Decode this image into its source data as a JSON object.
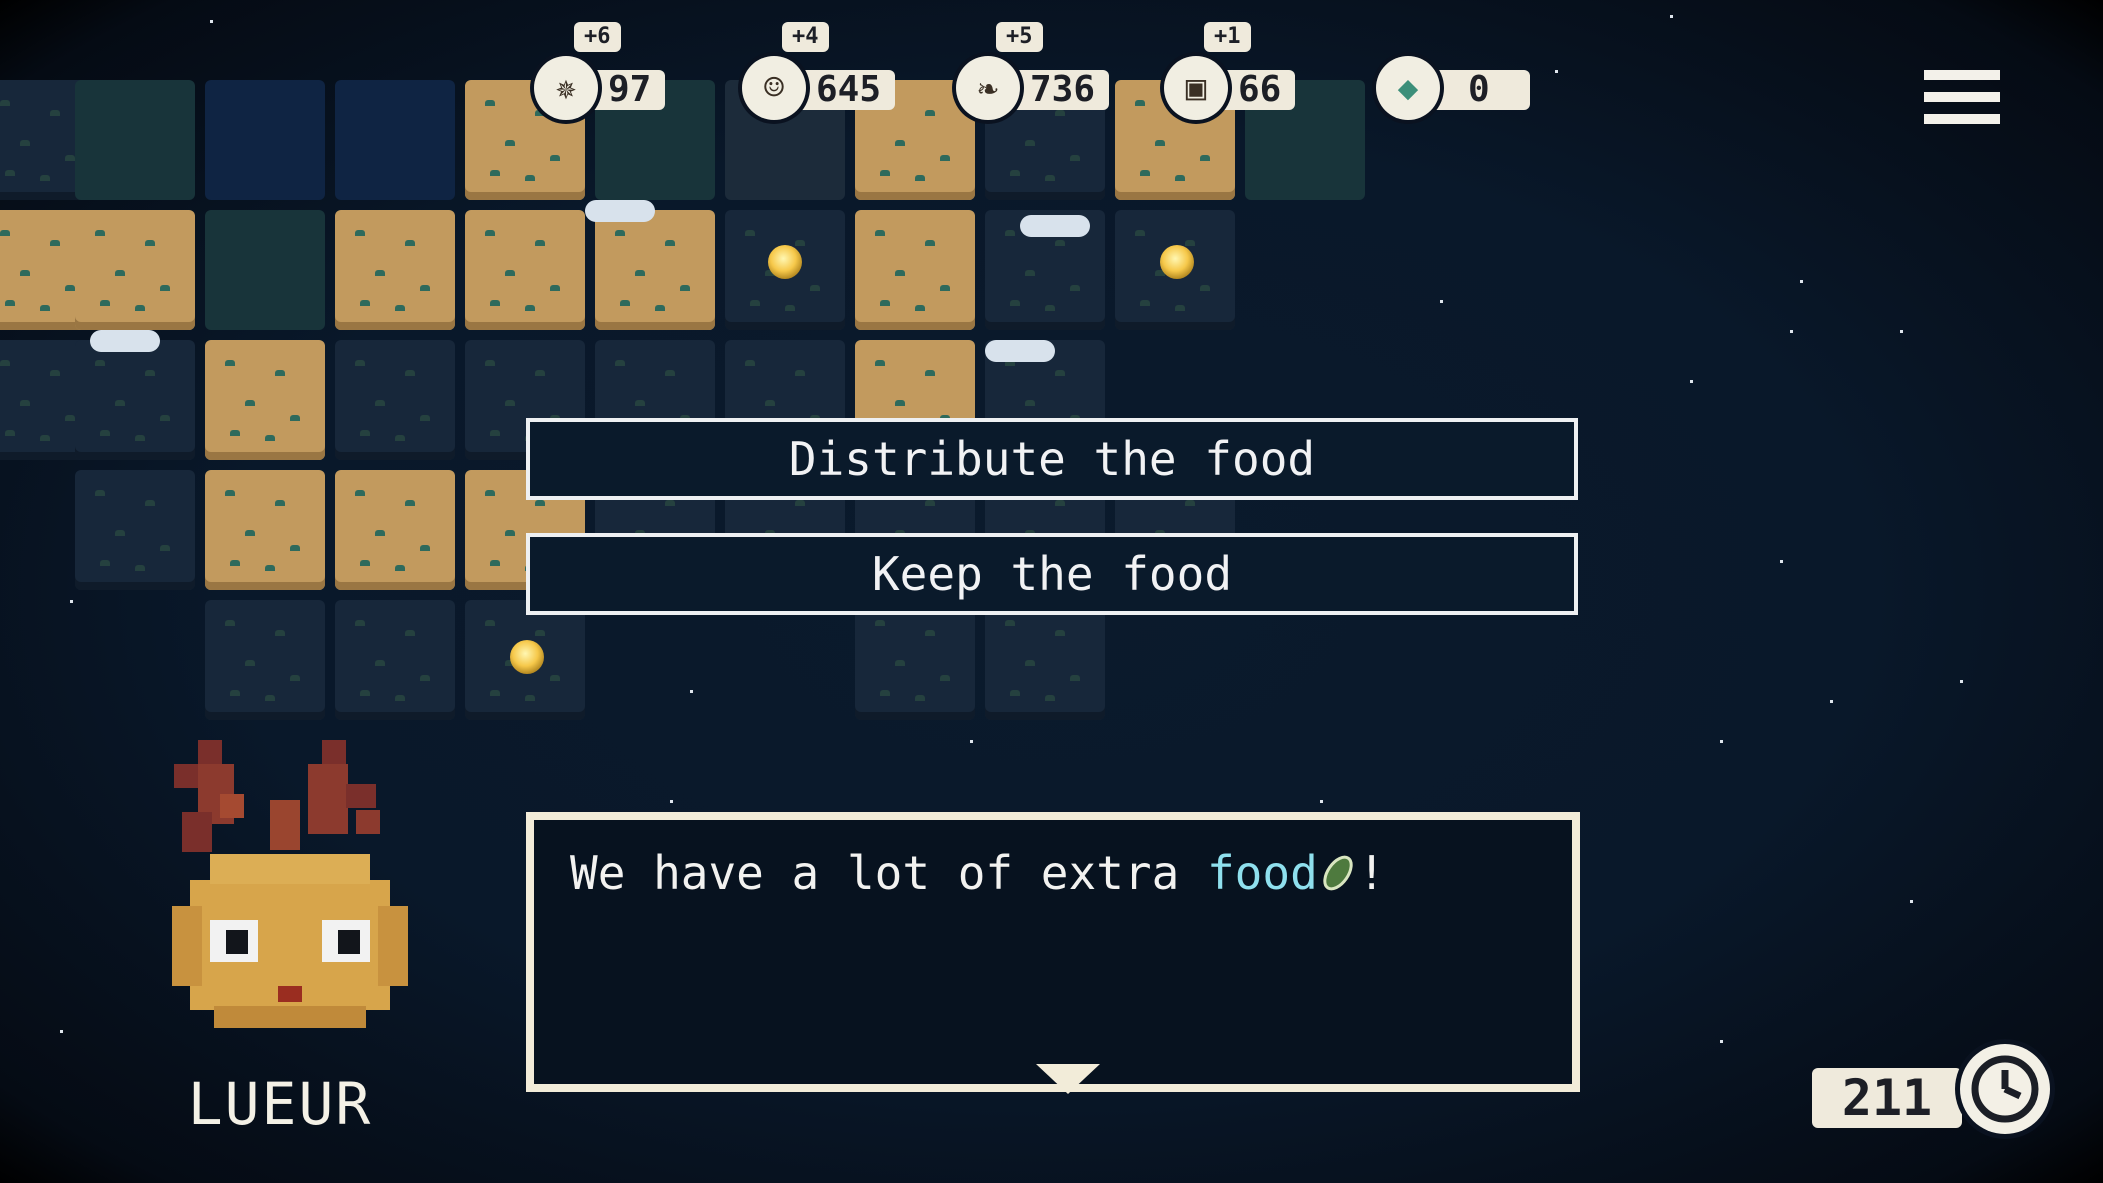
{
  "hud": {
    "resources": [
      {
        "icon": "energy-icon",
        "symbol": "✵",
        "value": "97",
        "delta": "+6"
      },
      {
        "icon": "population-icon",
        "symbol": "☺",
        "value": "645",
        "delta": "+4"
      },
      {
        "icon": "food-icon",
        "symbol": "❧",
        "value": "736",
        "delta": "+5"
      },
      {
        "icon": "materials-icon",
        "symbol": "▣",
        "value": "66",
        "delta": "+1"
      },
      {
        "icon": "crystal-icon",
        "symbol": "◆",
        "value": "0",
        "delta": ""
      }
    ],
    "menu_icon": "hamburger-menu-icon"
  },
  "choices": [
    {
      "label": "Distribute the food"
    },
    {
      "label": "Keep the food"
    }
  ],
  "dialog": {
    "text_before": "We have a lot of extra ",
    "keyword": "food",
    "keyword_icon": "food-icon",
    "text_after": "!"
  },
  "speaker": {
    "name": "LUEUR"
  },
  "turn": {
    "value": "211",
    "icon": "clock-icon"
  },
  "colors": {
    "background": "#09182a",
    "land": "#c29a5e",
    "dialog_border": "#f2ecd9",
    "keyword": "#8fe0ee"
  }
}
